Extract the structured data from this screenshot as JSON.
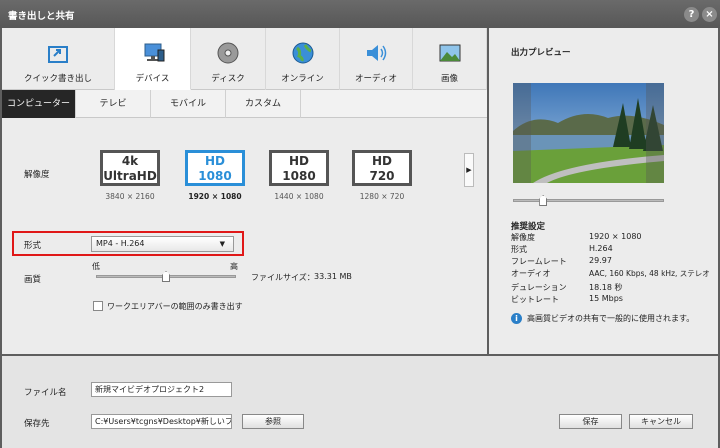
{
  "window": {
    "title": "書き出しと共有",
    "help_label": "?",
    "close_label": "×"
  },
  "top_tabs": [
    {
      "label": "クイック書き出し",
      "icon": "quick-export-icon"
    },
    {
      "label": "デバイス",
      "icon": "device-icon"
    },
    {
      "label": "ディスク",
      "icon": "disc-icon"
    },
    {
      "label": "オンライン",
      "icon": "globe-icon"
    },
    {
      "label": "オーディオ",
      "icon": "speaker-icon"
    },
    {
      "label": "画像",
      "icon": "image-icon"
    }
  ],
  "sub_tabs": [
    "コンピューター",
    "テレビ",
    "モバイル",
    "カスタム"
  ],
  "resolution": {
    "label": "解像度",
    "options": [
      {
        "line1": "4k",
        "line2": "UltraHD",
        "size": "3840 × 2160"
      },
      {
        "line1": "HD",
        "line2": "1080",
        "size": "1920 × 1080"
      },
      {
        "line1": "HD",
        "line2": "1080",
        "size": "1440 × 1080"
      },
      {
        "line1": "HD",
        "line2": "720",
        "size": "1280 × 720"
      }
    ],
    "more_arrow": "▶"
  },
  "format": {
    "label": "形式",
    "value": "MP4 - H.264",
    "arrow": "▼"
  },
  "quality": {
    "label": "画質",
    "low": "低",
    "high": "高",
    "level": 0.5
  },
  "file_size": {
    "label": "ファイルサイズ：",
    "value": "33.31 MB"
  },
  "work_area": {
    "label": "ワークエリアバーの範囲のみ書き出す"
  },
  "preview": {
    "title": "出力プレビュー",
    "position": 0.2
  },
  "specs": {
    "heading": "推奨設定",
    "rows": [
      {
        "k": "解像度",
        "v": "1920 × 1080"
      },
      {
        "k": "形式",
        "v": "H.264"
      },
      {
        "k": "フレームレート",
        "v": "29.97"
      },
      {
        "k": "オーディオ",
        "v": "AAC, 160 Kbps, 48 kHz, ステレオ"
      },
      {
        "k": "デュレーション",
        "v": "18.18 秒"
      },
      {
        "k": "ビットレート",
        "v": "15 Mbps"
      }
    ]
  },
  "info": {
    "text": "高画質ビデオの共有で一般的に使用されます。"
  },
  "bottom": {
    "filename_label": "ファイル名",
    "filename_value": "新規マイビデオプロジェクト2",
    "dest_label": "保存先",
    "dest_value": "C:¥Users¥tcgns¥Desktop¥新しいフォルダー",
    "browse_label": "参照",
    "save_label": "保存",
    "cancel_label": "キャンセル"
  },
  "colors": {
    "accent": "#2a8fd8",
    "highlight": "#e01818"
  }
}
